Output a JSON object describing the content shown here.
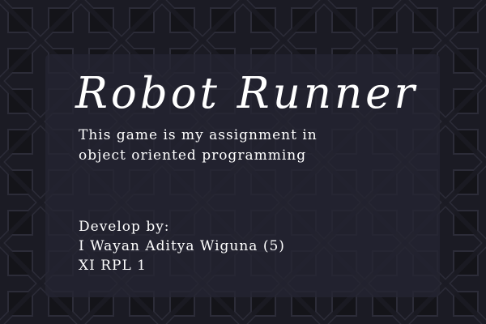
{
  "game": {
    "title": "Robot Runner",
    "description_lines": [
      "This game is my assignment in",
      "object oriented programming"
    ],
    "credits_lines": [
      "Develop by:",
      "I Wayan Aditya Wiguna (5)",
      "XI RPL 1"
    ]
  },
  "colors": {
    "background": "#1b1b24",
    "tile_fill": "#141419",
    "tile_edge": "#2c2c38",
    "panel": "#242432",
    "text": "#ffffff"
  }
}
